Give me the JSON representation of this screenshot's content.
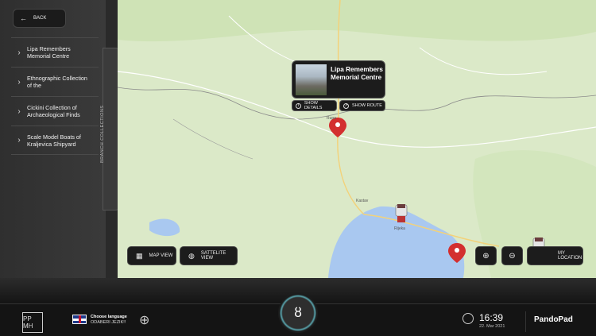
{
  "sidebar": {
    "back_label": "BACK",
    "items": [
      {
        "label": "Lipa Remembers Memorial Centre"
      },
      {
        "label": "Ethnographic Collection of the"
      },
      {
        "label": "Cickini Collection of Archaeological Finds"
      },
      {
        "label": "Scale Model Boats of Kraljevica Shipyard"
      }
    ],
    "handle_label": "BRANCH COLLECTIONS"
  },
  "map": {
    "popup": {
      "title": "Lipa Remembers Memorial Centre",
      "show_details": "SHOW DETAILS",
      "show_route": "SHOW ROUTE"
    },
    "map_view_label": "MAP VIEW",
    "satellite_view_label": "SATTELITE VIEW",
    "my_location_label": "MY LOCATION",
    "towns": [
      "Rupa",
      "Rijeka",
      "Kastav"
    ]
  },
  "bottom": {
    "lang_title": "Choose language",
    "lang_sub": "ODABERI JEZIK!!",
    "time": "16:39",
    "date": "22. Mar 2021",
    "brand": "PandoPad",
    "logo_text": "PP MH"
  },
  "colors": {
    "accent": "#5aa7b0",
    "pin": "#d32f2f",
    "map_land": "#dbe9c8",
    "sea": "#a9c8f0"
  }
}
